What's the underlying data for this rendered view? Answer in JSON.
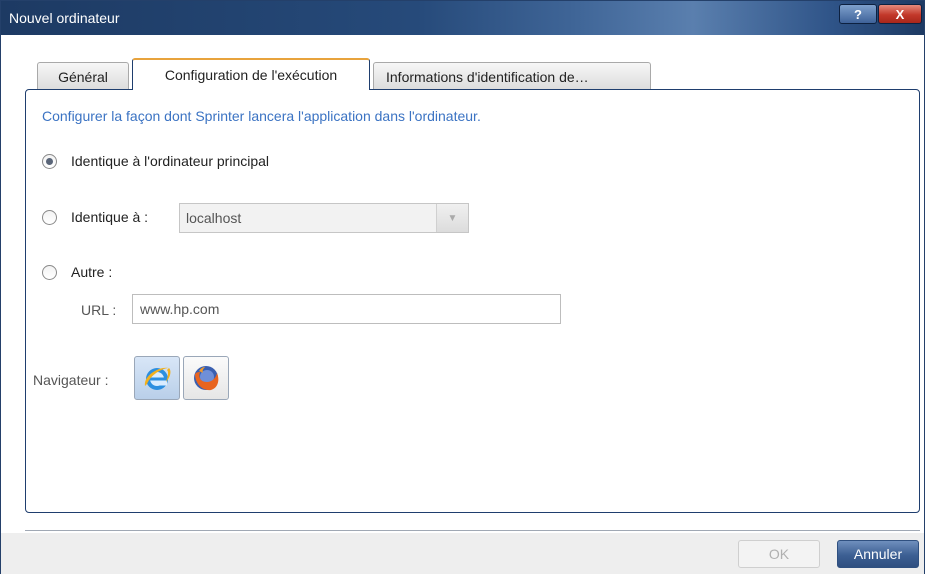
{
  "window": {
    "title": "Nouvel ordinateur",
    "help_label": "?",
    "close_label": "X"
  },
  "tabs": [
    {
      "label": "Général",
      "active": false
    },
    {
      "label": "Configuration de l'exécution",
      "active": true
    },
    {
      "label": "Informations d'identification de…",
      "active": false
    }
  ],
  "panel": {
    "intro": "Configurer la façon dont Sprinter lancera l'application dans l'ordinateur.",
    "options": [
      {
        "label": "Identique à l'ordinateur principal",
        "checked": true
      },
      {
        "label": "Identique à :",
        "checked": false
      },
      {
        "label": "Autre :",
        "checked": false
      }
    ],
    "same_as_select": {
      "value": "localhost"
    },
    "url": {
      "label": "URL :",
      "value": "www.hp.com"
    },
    "browser": {
      "label": "Navigateur :",
      "options": [
        {
          "icon": "internet-explorer-icon",
          "selected": true
        },
        {
          "icon": "firefox-icon",
          "selected": false
        }
      ]
    }
  },
  "footer": {
    "ok_label": "OK",
    "cancel_label": "Annuler"
  },
  "colors": {
    "title_bar": "#264a7a",
    "accent_blue": "#3b73c3",
    "active_tab_top": "#e8a33c",
    "close_button": "#c2382a"
  }
}
